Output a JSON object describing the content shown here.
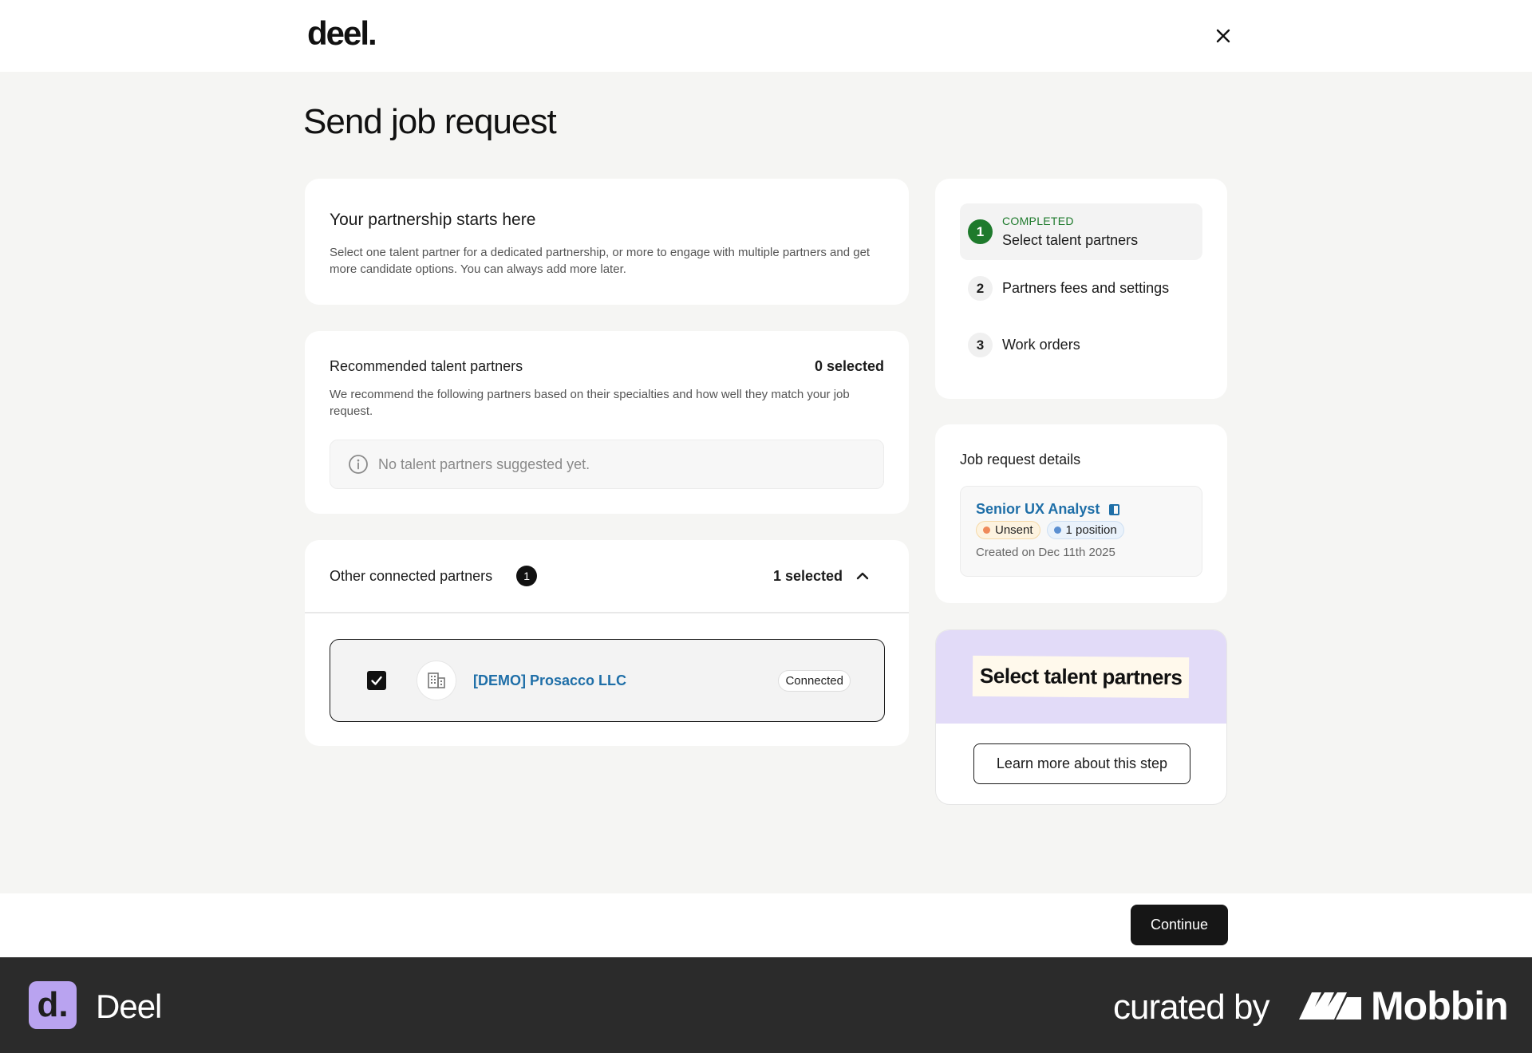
{
  "header": {
    "logo_text": "deel."
  },
  "page": {
    "title": "Send job request"
  },
  "intro": {
    "heading": "Your partnership starts here",
    "body": "Select one talent partner for a dedicated partnership, or more to engage with multiple partners and get more candidate options. You can always add more later."
  },
  "recommended": {
    "title": "Recommended talent partners",
    "count": "0 selected",
    "body": "We recommend the following partners based on their specialties and how well they match your job request.",
    "empty_text": "No talent partners suggested yet."
  },
  "other": {
    "title": "Other connected partners",
    "badge": "1",
    "selected": "1 selected",
    "partners": [
      {
        "name": "[DEMO] Prosacco LLC",
        "status": "Connected",
        "checked": true
      }
    ]
  },
  "steps": [
    {
      "num": "1",
      "status": "COMPLETED",
      "label": "Select talent partners"
    },
    {
      "num": "2",
      "status": "",
      "label": "Partners fees and settings"
    },
    {
      "num": "3",
      "status": "",
      "label": "Work orders"
    }
  ],
  "job_details": {
    "heading": "Job request details",
    "title": "Senior UX Analyst",
    "status_pill": "Unsent",
    "position_pill": "1 position",
    "created": "Created on Dec 11th 2025"
  },
  "learn": {
    "banner_text": "Select talent partners",
    "button_label": "Learn more about this step"
  },
  "footer_bar": {
    "continue_label": "Continue"
  },
  "branding": {
    "app_mark": "d.",
    "app_name": "Deel",
    "curated_by": "curated by",
    "mobbin": "Mobbin"
  },
  "colors": {
    "accent_green": "#1e7a2c",
    "link_blue": "#1f6fa8",
    "banner_purple": "#e2dbf8",
    "footer_dark": "#2b2b2b"
  }
}
